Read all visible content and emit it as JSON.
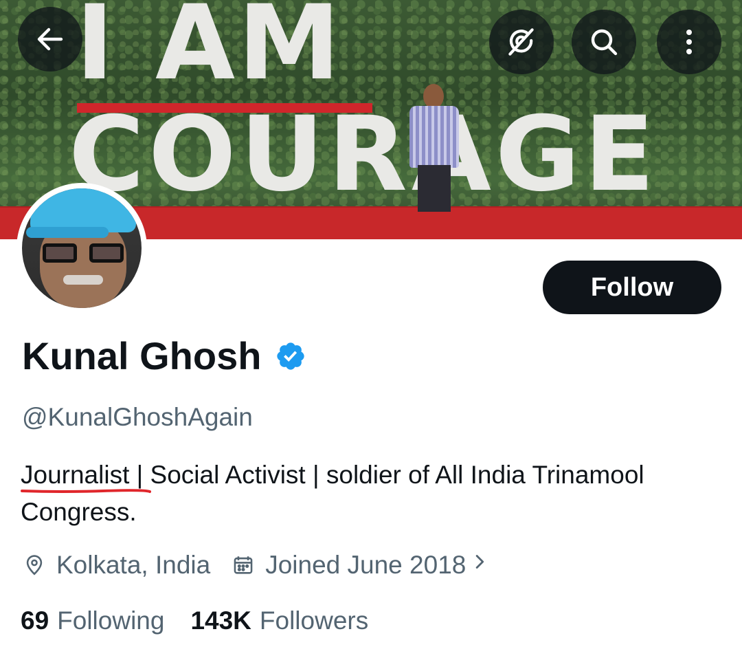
{
  "banner": {
    "sign_line1": "I AM",
    "sign_line2": "COURAGE"
  },
  "nav": {
    "back_icon": "arrow-left-icon",
    "grok_icon": "grok-icon",
    "search_icon": "search-icon",
    "more_icon": "more-vertical-icon"
  },
  "profile": {
    "follow_label": "Follow",
    "display_name": "Kunal Ghosh",
    "verified": true,
    "handle": "@KunalGhoshAgain",
    "bio": "Journalist | Social Activist | soldier of All India Trinamool Congress.",
    "location": "Kolkata, India",
    "joined": "Joined June 2018",
    "following_count": "69",
    "following_label": "Following",
    "followers_count": "143K",
    "followers_label": "Followers"
  },
  "colors": {
    "primary_text": "#0f1419",
    "secondary_text": "#536471",
    "verified_blue": "#1d9bf0",
    "underline_red": "#e0262b"
  }
}
